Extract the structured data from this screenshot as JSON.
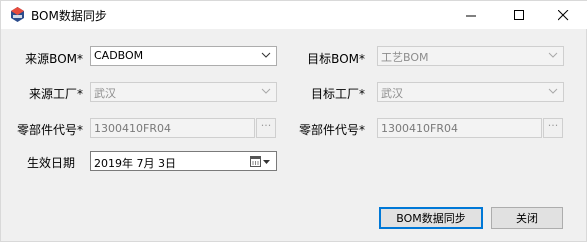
{
  "window": {
    "title": "BOM数据同步"
  },
  "form": {
    "source_bom": {
      "label": "来源BOM*",
      "value": "CADBOM"
    },
    "target_bom": {
      "label": "目标BOM*",
      "value": "工艺BOM"
    },
    "source_factory": {
      "label": "来源工厂*",
      "value": "武汉"
    },
    "target_factory": {
      "label": "目标工厂*",
      "value": "武汉"
    },
    "part_code_left": {
      "label": "零部件代号*",
      "value": "1300410FR04",
      "browse": "···"
    },
    "part_code_right": {
      "label": "零部件代号*",
      "value": "1300410FR04",
      "browse": "···"
    },
    "effective_date": {
      "label": "生效日期",
      "value": "2019年  7月  3日"
    }
  },
  "buttons": {
    "sync": "BOM数据同步",
    "close": "关闭"
  },
  "icons": [
    "app-icon",
    "minimize-icon",
    "maximize-icon",
    "close-icon",
    "chevron-down-icon",
    "calendar-icon"
  ]
}
